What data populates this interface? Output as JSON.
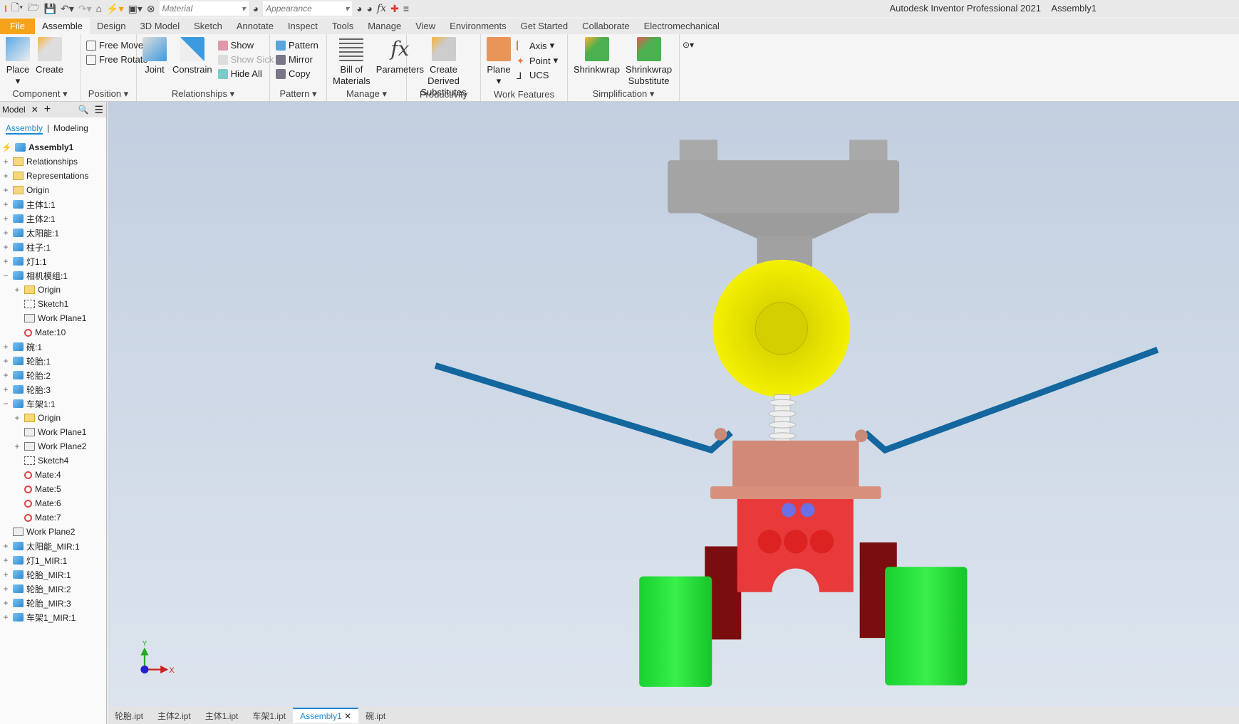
{
  "app": {
    "title": "Autodesk Inventor Professional 2021",
    "doc": "Assembly1"
  },
  "qat": {
    "material": "Material",
    "appearance": "Appearance"
  },
  "tabs": [
    "File",
    "Assemble",
    "Design",
    "3D Model",
    "Sketch",
    "Annotate",
    "Inspect",
    "Tools",
    "Manage",
    "View",
    "Environments",
    "Get Started",
    "Collaborate",
    "Electromechanical"
  ],
  "ribbon": {
    "component": {
      "label": "Component",
      "place": "Place",
      "create": "Create"
    },
    "position": {
      "label": "Position",
      "free_move": "Free Move",
      "free_rotate": "Free Rotate"
    },
    "relationships": {
      "label": "Relationships",
      "joint": "Joint",
      "constrain": "Constrain",
      "show": "Show",
      "show_sick": "Show Sick",
      "hide_all": "Hide All"
    },
    "pattern": {
      "label": "Pattern",
      "pattern": "Pattern",
      "mirror": "Mirror",
      "copy": "Copy"
    },
    "manage": {
      "label": "Manage",
      "bom1": "Bill of",
      "bom2": "Materials",
      "parameters": "Parameters"
    },
    "productivity": {
      "label": "Productivity",
      "cds1": "Create Derived",
      "cds2": "Substitutes"
    },
    "work_features": {
      "label": "Work Features",
      "plane": "Plane",
      "axis": "Axis",
      "point": "Point",
      "ucs": "UCS"
    },
    "simplification": {
      "label": "Simplification",
      "shrinkwrap": "Shrinkwrap",
      "sws1": "Shrinkwrap",
      "sws2": "Substitute"
    }
  },
  "browser": {
    "title": "Model",
    "tab_assembly": "Assembly",
    "tab_modeling": "Modeling",
    "tree": [
      {
        "l": "Assembly1",
        "d": 0,
        "i": "asm",
        "pm": ""
      },
      {
        "l": "Relationships",
        "d": 0,
        "i": "fold",
        "pm": "+"
      },
      {
        "l": "Representations",
        "d": 0,
        "i": "fold",
        "pm": "+"
      },
      {
        "l": "Origin",
        "d": 0,
        "i": "fold",
        "pm": "+"
      },
      {
        "l": "主体1:1",
        "d": 0,
        "i": "part",
        "pm": "+"
      },
      {
        "l": "主体2:1",
        "d": 0,
        "i": "part",
        "pm": "+"
      },
      {
        "l": "太阳能:1",
        "d": 0,
        "i": "part",
        "pm": "+"
      },
      {
        "l": "柱子:1",
        "d": 0,
        "i": "part",
        "pm": "+"
      },
      {
        "l": "灯1:1",
        "d": 0,
        "i": "part",
        "pm": "+"
      },
      {
        "l": "相机模组:1",
        "d": 0,
        "i": "part",
        "pm": "−"
      },
      {
        "l": "Origin",
        "d": 1,
        "i": "fold",
        "pm": "+"
      },
      {
        "l": "Sketch1",
        "d": 1,
        "i": "sk",
        "pm": ""
      },
      {
        "l": "Work Plane1",
        "d": 1,
        "i": "plane",
        "pm": ""
      },
      {
        "l": "Mate:10",
        "d": 1,
        "i": "mate",
        "pm": ""
      },
      {
        "l": "碗:1",
        "d": 0,
        "i": "part",
        "pm": "+"
      },
      {
        "l": "轮胎:1",
        "d": 0,
        "i": "part",
        "pm": "+"
      },
      {
        "l": "轮胎:2",
        "d": 0,
        "i": "part",
        "pm": "+"
      },
      {
        "l": "轮胎:3",
        "d": 0,
        "i": "part",
        "pm": "+"
      },
      {
        "l": "车架1:1",
        "d": 0,
        "i": "part",
        "pm": "−"
      },
      {
        "l": "Origin",
        "d": 1,
        "i": "fold",
        "pm": "+"
      },
      {
        "l": "Work Plane1",
        "d": 1,
        "i": "plane",
        "pm": ""
      },
      {
        "l": "Work Plane2",
        "d": 1,
        "i": "plane",
        "pm": "+"
      },
      {
        "l": "Sketch4",
        "d": 1,
        "i": "sk",
        "pm": ""
      },
      {
        "l": "Mate:4",
        "d": 1,
        "i": "mate",
        "pm": ""
      },
      {
        "l": "Mate:5",
        "d": 1,
        "i": "mate",
        "pm": ""
      },
      {
        "l": "Mate:6",
        "d": 1,
        "i": "mate",
        "pm": ""
      },
      {
        "l": "Mate:7",
        "d": 1,
        "i": "mate",
        "pm": ""
      },
      {
        "l": "Work Plane2",
        "d": 0,
        "i": "plane",
        "pm": ""
      },
      {
        "l": "太阳能_MIR:1",
        "d": 0,
        "i": "part",
        "pm": "+"
      },
      {
        "l": "灯1_MIR:1",
        "d": 0,
        "i": "part",
        "pm": "+"
      },
      {
        "l": "轮胎_MIR:1",
        "d": 0,
        "i": "part",
        "pm": "+"
      },
      {
        "l": "轮胎_MIR:2",
        "d": 0,
        "i": "part",
        "pm": "+"
      },
      {
        "l": "轮胎_MIR:3",
        "d": 0,
        "i": "part",
        "pm": "+"
      },
      {
        "l": "车架1_MIR:1",
        "d": 0,
        "i": "part",
        "pm": "+"
      }
    ]
  },
  "triad": {
    "x": "X",
    "y": "Y"
  },
  "doc_tabs": [
    "轮胎.ipt",
    "主体2.ipt",
    "主体1.ipt",
    "车架1.ipt",
    "Assembly1",
    "碗.ipt"
  ],
  "active_doc_tab": 4
}
